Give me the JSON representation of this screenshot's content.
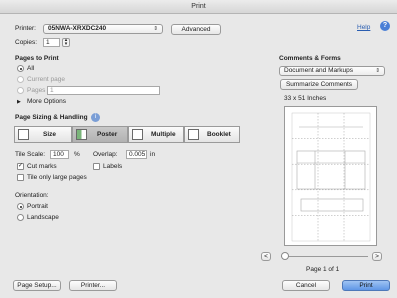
{
  "window": {
    "title": "Print"
  },
  "printer": {
    "label": "Printer:",
    "value": "05NWA-XRXDC240",
    "advanced_label": "Advanced"
  },
  "help": {
    "link": "Help",
    "icon": "help-icon"
  },
  "copies": {
    "label": "Copies:",
    "value": "1"
  },
  "pages": {
    "heading": "Pages to Print",
    "options": [
      {
        "label": "All",
        "selected": true,
        "enabled": true
      },
      {
        "label": "Current page",
        "selected": false,
        "enabled": false
      },
      {
        "label": "Pages",
        "selected": false,
        "enabled": false
      }
    ],
    "pages_value": "1",
    "more_options": "More Options"
  },
  "sizing": {
    "heading": "Page Sizing & Handling",
    "modes": [
      "Size",
      "Poster",
      "Multiple",
      "Booklet"
    ],
    "active_mode": "Poster",
    "tile_scale_label": "Tile Scale:",
    "tile_scale_value": "100",
    "tile_scale_unit": "%",
    "overlap_label": "Overlap:",
    "overlap_value": "0.005",
    "overlap_unit": "in",
    "cut_marks": {
      "label": "Cut marks",
      "checked": true
    },
    "labels": {
      "label": "Labels",
      "checked": false
    },
    "tile_large": {
      "label": "Tile only large pages",
      "checked": false
    }
  },
  "orientation": {
    "heading": "Orientation:",
    "options": [
      {
        "label": "Portrait",
        "selected": true
      },
      {
        "label": "Landscape",
        "selected": false
      }
    ]
  },
  "comments": {
    "heading": "Comments & Forms",
    "value": "Document and Markups",
    "summarize_label": "Summarize Comments",
    "dimensions": "33 x 51 Inches"
  },
  "preview": {
    "page_text": "Page 1 of 1",
    "prev": "<",
    "next": ">",
    "tiles_cols": 3,
    "tiles_rows": 5
  },
  "footer": {
    "page_setup": "Page Setup...",
    "printer": "Printer...",
    "cancel": "Cancel",
    "print": "Print"
  }
}
